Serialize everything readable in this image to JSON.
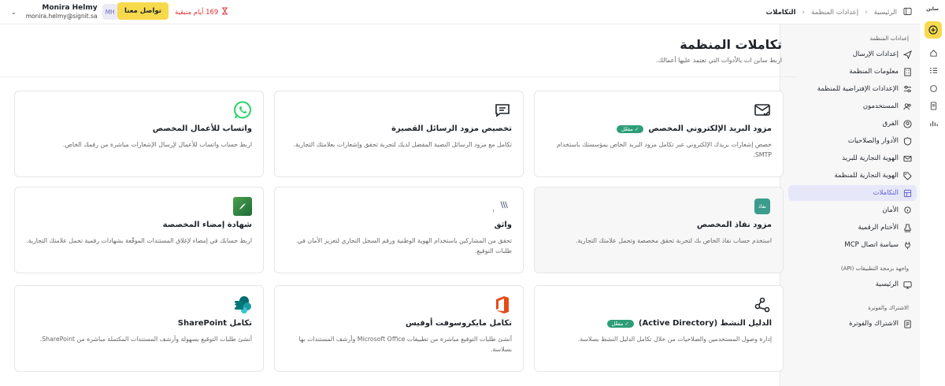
{
  "app": {
    "brand": "ساين"
  },
  "topbar": {
    "breadcrumb": [
      "الرئيسية",
      "إعدادات المنظمة",
      "التكاملات"
    ],
    "trial_text": "169 أيام متبقية",
    "contact_label": "تواصل معنا",
    "user": {
      "initials": "MH",
      "name": "Monira Helmy",
      "email": "monira.helmy@signit.sa"
    }
  },
  "sidebar": {
    "org_section": "إعدادات المنظمة",
    "org_items": [
      {
        "label": "إعدادات الإرسال",
        "icon": "send-icon"
      },
      {
        "label": "معلومات المنظمة",
        "icon": "building-icon"
      },
      {
        "label": "الإعدادات الإفتراضية للمنظمة",
        "icon": "sliders-icon"
      },
      {
        "label": "المستخدمون",
        "icon": "users-icon"
      },
      {
        "label": "الفرق",
        "icon": "team-icon"
      },
      {
        "label": "الأدوار والصلاحيات",
        "icon": "shield-icon"
      },
      {
        "label": "الهوية التجارية للبريد",
        "icon": "mail-icon"
      },
      {
        "label": "الهوية التجارية للمنظمة",
        "icon": "tag-icon"
      },
      {
        "label": "التكاملات",
        "icon": "grid-icon",
        "active": true
      },
      {
        "label": "الأمان",
        "icon": "lock-icon"
      },
      {
        "label": "الأختام الرقمية",
        "icon": "stamp-icon"
      },
      {
        "label": "سياسة اتصال MCP",
        "icon": "plug-icon"
      }
    ],
    "api_section": "واجهة برمجة التطبيقات (API)",
    "api_items": [
      {
        "label": "الرئيسية",
        "icon": "api-home-icon"
      }
    ],
    "billing_section": "الاشتراك والفوترة",
    "billing_items": [
      {
        "label": "الاشتراك والفوترة",
        "icon": "billing-icon"
      }
    ]
  },
  "page": {
    "title": "تكاملات المنظمة",
    "subtitle": "اربط ساين ات بالأدوات التي تعتمد عليها أعمالك."
  },
  "cards": [
    {
      "title": "مزود البريد الإلكتروني المخصص",
      "badge": "مفعّل",
      "desc": "خصص إشعارات بريدك الإلكتروني عبر تكامل مزود البريد الخاص بمؤسستك باستخدام SMTP.",
      "icon": "smtp-mail-icon"
    },
    {
      "title": "تخصيص مزود الرسائل القصيرة",
      "badge": "",
      "desc": "تكامل مع مزود الرسائل النصية المفضل لديك لتجربة تحقق وإشعارات بعلامتك التجارية.",
      "icon": "sms-icon"
    },
    {
      "title": "واتساب للأعمال المخصص",
      "badge": "",
      "desc": "اربط حساب واتساب للأعمال لإرسال الإشعارات مباشرة من رقمك الخاص.",
      "icon": "whatsapp-icon"
    },
    {
      "title": "مزود نفاذ المخصص",
      "badge": "",
      "desc": "استخدم حساب نفاذ الخاص بك لتجربة تحقق مخصصة وتحمل علامتك التجارية.",
      "icon": "nafath-icon",
      "icon_text": "نفاذ",
      "highlight": true
    },
    {
      "title": "واثق",
      "badge": "",
      "desc": "تحقق من المشاركين باستخدام الهوية الوطنية ورقم السجل التجاري لتعزيز الأمان في طلبات التوقيع.",
      "icon": "wathq-icon",
      "icon_text": "Wathq"
    },
    {
      "title": "شهادة إمضاء المخصصة",
      "badge": "",
      "desc": "اربط حسابك في إمضاء لإغلاق المستندات الموقّعة بشهادات رقمية تحمل علامتك التجارية.",
      "icon": "emdha-icon"
    },
    {
      "title": "الدليل النشط (Active Directory)",
      "badge": "مفعّل",
      "desc": "إدارة وصول المستخدمين والصلاحيات من خلال تكامل الدليل النشط بسلاسة.",
      "icon": "active-directory-icon"
    },
    {
      "title": "تكامل مايكروسوفت أوفيس",
      "badge": "",
      "desc": "أنشئ طلبات التوقيع مباشرة من تطبيقات Microsoft Office وأرشف المستندات بها بسلاسة.",
      "icon": "office-icon"
    },
    {
      "title": "تكامل SharePoint",
      "badge": "",
      "desc": "أنشئ طلبات التوقيع بسهولة وأرشف المستندات المكتملة مباشرة من SharePoint.",
      "icon": "sharepoint-icon"
    }
  ],
  "colors": {
    "accent": "#5b5fd6",
    "brand_yellow": "#f7d94c",
    "success": "#2e9e78",
    "danger": "#d33333"
  }
}
